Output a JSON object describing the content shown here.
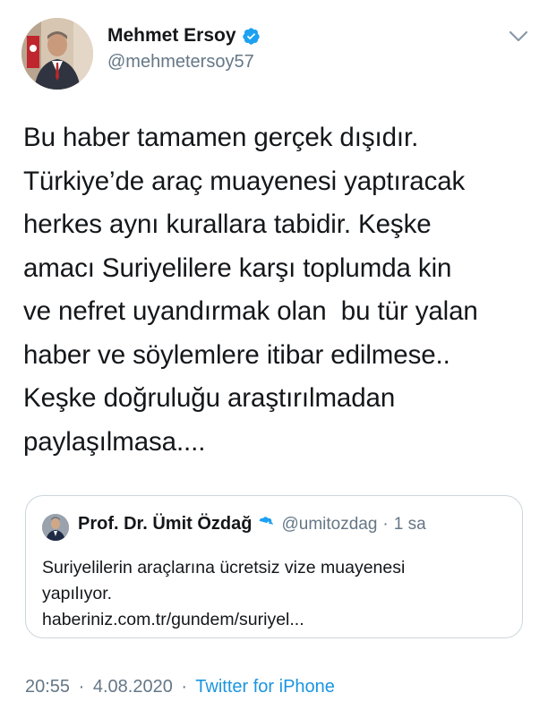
{
  "author": {
    "name": "Mehmet Ersoy",
    "handle": "@mehmetersoy57",
    "verified_icon": "verified-badge-icon",
    "menu_icon": "chevron-down-icon"
  },
  "tweet": {
    "text": "Bu haber tamamen gerçek dışıdır.\nTürkiye’de araç muayenesi yaptıracak\nherkes aynı kurallara tabidir. Keşke\namacı Suriyelilere karşı toplumda kin\nve nefret uyandırmak olan  bu tür yalan\nhaber ve söylemlere itibar edilmese..\nKeşke doğruluğu araştırılmadan\npaylaşılmasa...."
  },
  "quoted_tweet": {
    "name": "Prof. Dr. Ümit Özdağ",
    "handle": "@umitozdag",
    "separator": "·",
    "time": "1 sa",
    "text": "Suriyelilerin araçlarına ücretsiz vize muayenesi\nyapılıyor.\nhaberiniz.com.tr/gundem/suriyel..."
  },
  "footer": {
    "time": "20:55",
    "separator": "·",
    "date": "4.08.2020",
    "source": "Twitter for iPhone"
  },
  "colors": {
    "primary_text": "#14171a",
    "secondary_text": "#657786",
    "link": "#1b95e0",
    "verified_badge": "#1da1f2",
    "border": "#ccd6dd"
  }
}
